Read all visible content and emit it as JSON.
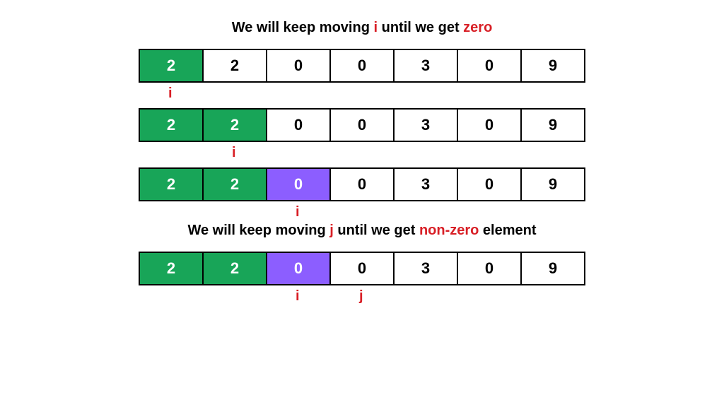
{
  "colors": {
    "green": "#18a558",
    "purple": "#8c5eff",
    "red": "#d81f26"
  },
  "captions": {
    "top": {
      "pre": "We will keep moving ",
      "var": "i",
      "mid": " until we get ",
      "hl": "zero",
      "post": ""
    },
    "bottom": {
      "pre": "We will keep moving ",
      "var": "j",
      "mid": " until we get ",
      "hl": "non-zero",
      "post": " element"
    }
  },
  "array_values": [
    2,
    2,
    0,
    0,
    3,
    0,
    9
  ],
  "rows": [
    {
      "cells": [
        {
          "value": 2,
          "class": "green"
        },
        {
          "value": 2,
          "class": ""
        },
        {
          "value": 0,
          "class": ""
        },
        {
          "value": 0,
          "class": ""
        },
        {
          "value": 3,
          "class": ""
        },
        {
          "value": 0,
          "class": ""
        },
        {
          "value": 9,
          "class": ""
        }
      ],
      "pointers": [
        {
          "label": "i",
          "index": 0
        }
      ]
    },
    {
      "cells": [
        {
          "value": 2,
          "class": "green"
        },
        {
          "value": 2,
          "class": "green"
        },
        {
          "value": 0,
          "class": ""
        },
        {
          "value": 0,
          "class": ""
        },
        {
          "value": 3,
          "class": ""
        },
        {
          "value": 0,
          "class": ""
        },
        {
          "value": 9,
          "class": ""
        }
      ],
      "pointers": [
        {
          "label": "i",
          "index": 1
        }
      ]
    },
    {
      "cells": [
        {
          "value": 2,
          "class": "green"
        },
        {
          "value": 2,
          "class": "green"
        },
        {
          "value": 0,
          "class": "purple"
        },
        {
          "value": 0,
          "class": ""
        },
        {
          "value": 3,
          "class": ""
        },
        {
          "value": 0,
          "class": ""
        },
        {
          "value": 9,
          "class": ""
        }
      ],
      "pointers": [
        {
          "label": "i",
          "index": 2
        }
      ]
    },
    {
      "cells": [
        {
          "value": 2,
          "class": "green"
        },
        {
          "value": 2,
          "class": "green"
        },
        {
          "value": 0,
          "class": "purple"
        },
        {
          "value": 0,
          "class": ""
        },
        {
          "value": 3,
          "class": ""
        },
        {
          "value": 0,
          "class": ""
        },
        {
          "value": 9,
          "class": ""
        }
      ],
      "pointers": [
        {
          "label": "i",
          "index": 2
        },
        {
          "label": "j",
          "index": 3
        }
      ]
    }
  ]
}
